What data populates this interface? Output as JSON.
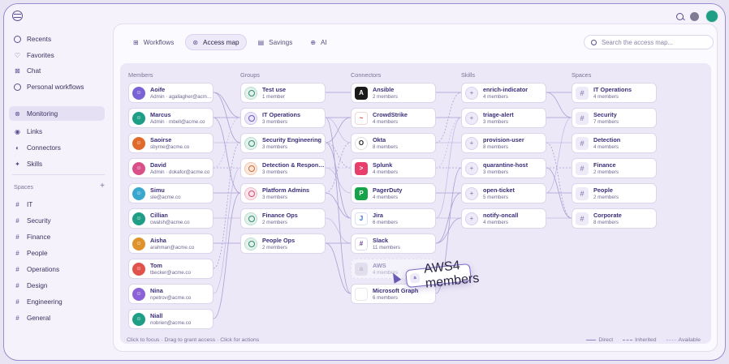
{
  "sidebar": {
    "nav": [
      {
        "label": "Recents",
        "icon": "clock-icon"
      },
      {
        "label": "Favorites",
        "icon": "heart-icon"
      },
      {
        "label": "Chat",
        "icon": "chat-icon"
      },
      {
        "label": "Personal workflows",
        "icon": "user-circle-icon"
      },
      {
        "label": "Monitoring",
        "icon": "monitor-icon"
      },
      {
        "label": "Links",
        "icon": "link-icon"
      },
      {
        "label": "Connectors",
        "icon": "plug-icon"
      },
      {
        "label": "Skills",
        "icon": "sparkle-icon"
      }
    ],
    "spaces_label": "Spaces",
    "spaces": [
      "IT",
      "Security",
      "Finance",
      "People",
      "Operations",
      "Design",
      "Engineering",
      "General"
    ]
  },
  "tabs": [
    {
      "label": "Workflows",
      "icon": "workflow-icon"
    },
    {
      "label": "Access map",
      "icon": "map-icon"
    },
    {
      "label": "Savings",
      "icon": "wallet-icon"
    },
    {
      "label": "AI",
      "icon": "ai-icon"
    }
  ],
  "search": {
    "placeholder": "Search the access map..."
  },
  "columns": {
    "members": "Members",
    "groups": "Groups",
    "connectors": "Connectors",
    "skills": "Skills",
    "spaces": "Spaces"
  },
  "members": [
    {
      "name": "Aoife",
      "sub": "Admin · agallagher@acme.co",
      "color": "#7b63d6"
    },
    {
      "name": "Marcus",
      "sub": "Admin · mbell@acme.co",
      "color": "#1e9e84"
    },
    {
      "name": "Saoirse",
      "sub": "sbyrne@acme.co",
      "color": "#e06a2a"
    },
    {
      "name": "David",
      "sub": "Admin · dokafor@acme.co",
      "color": "#d94f88"
    },
    {
      "name": "Simu",
      "sub": "sle@acme.co",
      "color": "#3aa7cf"
    },
    {
      "name": "Cillian",
      "sub": "cwalsh@acme.co",
      "color": "#1e9e84"
    },
    {
      "name": "Aisha",
      "sub": "arahman@acme.co",
      "color": "#e0922a"
    },
    {
      "name": "Tom",
      "sub": "tbecker@acme.co",
      "color": "#e0524a"
    },
    {
      "name": "Nina",
      "sub": "npetrov@acme.co",
      "color": "#8b63d6"
    },
    {
      "name": "Niall",
      "sub": "nobrien@acme.co",
      "color": "#1e9e84"
    }
  ],
  "groups": [
    {
      "name": "Test use",
      "sub": "1 member",
      "style": "green"
    },
    {
      "name": "IT Operations",
      "sub": "3 members",
      "style": "lilac"
    },
    {
      "name": "Security Engineering",
      "sub": "3 members",
      "style": "green"
    },
    {
      "name": "Detection & Response",
      "sub": "3 members",
      "style": "orange"
    },
    {
      "name": "Platform Admins",
      "sub": "3 members",
      "style": "pink"
    },
    {
      "name": "Finance Ops",
      "sub": "2 members",
      "style": "green"
    },
    {
      "name": "People Ops",
      "sub": "2 members",
      "style": "green"
    }
  ],
  "connectors": [
    {
      "name": "Ansible",
      "sub": "2 members",
      "color": "#1a1a1a",
      "glyph": "A"
    },
    {
      "name": "CrowdStrike",
      "sub": "4 members",
      "color": "#e3342f",
      "glyph": "~"
    },
    {
      "name": "Okta",
      "sub": "8 members",
      "color": "#222222",
      "glyph": "O"
    },
    {
      "name": "Splunk",
      "sub": "4 members",
      "color": "#e83e6c",
      "glyph": ">"
    },
    {
      "name": "PagerDuty",
      "sub": "4 members",
      "color": "#15a34a",
      "glyph": "P"
    },
    {
      "name": "Jira",
      "sub": "6 members",
      "color": "#2f6fdc",
      "glyph": "J"
    },
    {
      "name": "Slack",
      "sub": "11 members",
      "color": "#6b3fa0",
      "glyph": "#"
    },
    {
      "name": "AWS",
      "sub": "4 members",
      "color": "#b9b4c9",
      "glyph": "a"
    },
    {
      "name": "Microsoft Graph",
      "sub": "6 members",
      "color": "#f25022",
      "glyph": "M"
    }
  ],
  "drag": {
    "name": "AWS",
    "sub": "4 members"
  },
  "skills": [
    {
      "name": "enrich-indicator",
      "sub": "4 members"
    },
    {
      "name": "triage-alert",
      "sub": "3 members"
    },
    {
      "name": "provision-user",
      "sub": "8 members"
    },
    {
      "name": "quarantine-host",
      "sub": "3 members"
    },
    {
      "name": "open-ticket",
      "sub": "5 members"
    },
    {
      "name": "notify-oncall",
      "sub": "4 members"
    }
  ],
  "spaces_col": [
    {
      "name": "IT Operations",
      "sub": "4 members"
    },
    {
      "name": "Security",
      "sub": "7 members"
    },
    {
      "name": "Detection",
      "sub": "4 members"
    },
    {
      "name": "Finance",
      "sub": "2 members"
    },
    {
      "name": "People",
      "sub": "2 members"
    },
    {
      "name": "Corporate",
      "sub": "8 members"
    }
  ],
  "footer": {
    "hint": "Click to focus · Drag to grant access · Click   for actions"
  },
  "legend": {
    "direct": "Direct",
    "inherited": "Inherited",
    "available": "Available"
  }
}
